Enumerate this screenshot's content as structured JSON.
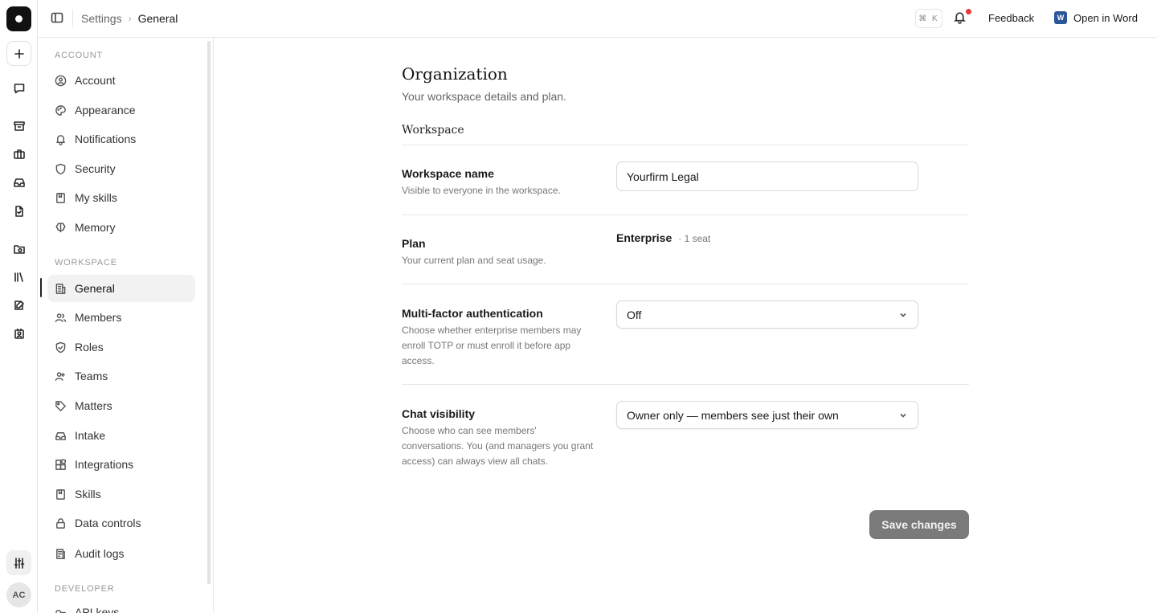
{
  "header": {
    "breadcrumb": [
      "Settings",
      "General"
    ],
    "shortcut": "⌘ K",
    "feedback": "Feedback",
    "open_in_word": "Open in Word",
    "notification_dot_color": "#e53935"
  },
  "rail": {
    "avatar_initials": "AC"
  },
  "sidebar": {
    "sections": {
      "account": "ACCOUNT",
      "workspace": "WORKSPACE",
      "developer": "DEVELOPER"
    },
    "account_items": [
      {
        "label": "Account",
        "icon": "user-circle-icon"
      },
      {
        "label": "Appearance",
        "icon": "palette-icon"
      },
      {
        "label": "Notifications",
        "icon": "bell-icon"
      },
      {
        "label": "Security",
        "icon": "shield-icon"
      },
      {
        "label": "My skills",
        "icon": "bookmark-icon"
      },
      {
        "label": "Memory",
        "icon": "brain-icon"
      }
    ],
    "workspace_items": [
      {
        "label": "General",
        "icon": "building-icon",
        "selected": true
      },
      {
        "label": "Members",
        "icon": "users-icon"
      },
      {
        "label": "Roles",
        "icon": "shield-check-icon"
      },
      {
        "label": "Teams",
        "icon": "team-icon"
      },
      {
        "label": "Matters",
        "icon": "tag-icon"
      },
      {
        "label": "Intake",
        "icon": "inbox-icon"
      },
      {
        "label": "Integrations",
        "icon": "blocks-icon"
      },
      {
        "label": "Skills",
        "icon": "book-icon"
      },
      {
        "label": "Data controls",
        "icon": "lock-icon"
      },
      {
        "label": "Audit logs",
        "icon": "log-icon"
      }
    ],
    "developer_items": [
      {
        "label": "API keys",
        "icon": "key-icon"
      }
    ]
  },
  "main": {
    "title": "Organization",
    "subtitle": "Your workspace details and plan.",
    "section": "Workspace",
    "workspace_name": {
      "label": "Workspace name",
      "description": "Visible to everyone in the workspace.",
      "value": "Yourfirm Legal"
    },
    "plan": {
      "label": "Plan",
      "description": "Your current plan and seat usage.",
      "name": "Enterprise",
      "seats": "· 1 seat"
    },
    "mfa": {
      "label": "Multi-factor authentication",
      "description": "Choose whether enterprise members may enroll TOTP or must enroll it before app access.",
      "value": "Off"
    },
    "chat_visibility": {
      "label": "Chat visibility",
      "description": "Choose who can see members' conversations. You (and managers you grant access) can always view all chats.",
      "value": "Owner only — members see just their own"
    },
    "save_label": "Save changes"
  }
}
